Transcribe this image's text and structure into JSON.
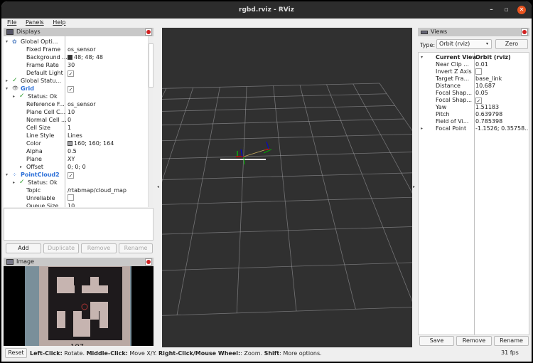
{
  "window": {
    "title": "rgbd.rviz - RViz",
    "minimize_icon": "minimize-icon",
    "maximize_icon": "maximize-icon",
    "close_icon": "close-icon"
  },
  "menu": [
    "File",
    "Panels",
    "Help"
  ],
  "displays": {
    "title": "Displays",
    "rows": [
      {
        "k": "Global Opti...",
        "v": "",
        "indent": 0,
        "exp": "down",
        "icon": "gear",
        "vtype": "text"
      },
      {
        "k": "Fixed Frame",
        "v": "os_sensor",
        "indent": 2,
        "vtype": "text"
      },
      {
        "k": "Background ...",
        "v": "48; 48; 48",
        "indent": 2,
        "vtype": "color",
        "color": "#303030"
      },
      {
        "k": "Frame Rate",
        "v": "30",
        "indent": 2,
        "vtype": "text"
      },
      {
        "k": "Default Light",
        "v": "✓",
        "indent": 2,
        "vtype": "check"
      },
      {
        "k": "Global Statu...",
        "v": "",
        "indent": 0,
        "exp": "right",
        "icon": "check",
        "vtype": "text"
      },
      {
        "k": "Grid",
        "v": "✓",
        "indent": 0,
        "exp": "down",
        "icon": "grid",
        "vtype": "check",
        "blue": true
      },
      {
        "k": "Status: Ok",
        "v": "",
        "indent": 1,
        "exp": "right",
        "icon": "check",
        "vtype": "text"
      },
      {
        "k": "Reference F...",
        "v": "os_sensor",
        "indent": 2,
        "vtype": "text"
      },
      {
        "k": "Plane Cell C...",
        "v": "10",
        "indent": 2,
        "vtype": "text"
      },
      {
        "k": "Normal Cell ...",
        "v": "0",
        "indent": 2,
        "vtype": "text"
      },
      {
        "k": "Cell Size",
        "v": "1",
        "indent": 2,
        "vtype": "text"
      },
      {
        "k": "Line Style",
        "v": "Lines",
        "indent": 2,
        "vtype": "text"
      },
      {
        "k": "Color",
        "v": "160; 160; 164",
        "indent": 2,
        "vtype": "color",
        "color": "#a0a0a4"
      },
      {
        "k": "Alpha",
        "v": "0.5",
        "indent": 2,
        "vtype": "text"
      },
      {
        "k": "Plane",
        "v": "XY",
        "indent": 2,
        "vtype": "text"
      },
      {
        "k": "Offset",
        "v": "0; 0; 0",
        "indent": 2,
        "exp": "right",
        "vtype": "text"
      },
      {
        "k": "PointCloud2",
        "v": "✓",
        "indent": 0,
        "exp": "down",
        "icon": "cloud",
        "vtype": "check",
        "blue": true
      },
      {
        "k": "Status: Ok",
        "v": "",
        "indent": 1,
        "exp": "right",
        "icon": "check",
        "vtype": "text"
      },
      {
        "k": "Topic",
        "v": "/rtabmap/cloud_map",
        "indent": 2,
        "vtype": "text"
      },
      {
        "k": "Unreliable",
        "v": "",
        "indent": 2,
        "vtype": "check"
      },
      {
        "k": "Queue Size",
        "v": "10",
        "indent": 2,
        "vtype": "text"
      }
    ],
    "buttons": {
      "add": "Add",
      "duplicate": "Duplicate",
      "remove": "Remove",
      "rename": "Rename"
    }
  },
  "image_panel": {
    "title": "Image",
    "marker_caption": "107"
  },
  "views": {
    "title": "Views",
    "type_label": "Type:",
    "type_value": "Orbit (rviz)",
    "zero": "Zero",
    "rows": [
      {
        "k": "Current View",
        "v": "Orbit (rviz)",
        "bold": true,
        "exp": "down",
        "vtype": "text"
      },
      {
        "k": "Near Clip ...",
        "v": "0.01",
        "vtype": "text"
      },
      {
        "k": "Invert Z Axis",
        "v": "",
        "vtype": "check"
      },
      {
        "k": "Target Fra...",
        "v": "base_link",
        "vtype": "text"
      },
      {
        "k": "Distance",
        "v": "10.687",
        "vtype": "text"
      },
      {
        "k": "Focal Shap...",
        "v": "0.05",
        "vtype": "text"
      },
      {
        "k": "Focal Shap...",
        "v": "✓",
        "vtype": "check"
      },
      {
        "k": "Yaw",
        "v": "1.51183",
        "vtype": "text"
      },
      {
        "k": "Pitch",
        "v": "0.639798",
        "vtype": "text"
      },
      {
        "k": "Field of Vi...",
        "v": "0.785398",
        "vtype": "text"
      },
      {
        "k": "Focal Point",
        "v": "-1.1526; 0.35758...",
        "exp": "right",
        "vtype": "text"
      }
    ],
    "buttons": {
      "save": "Save",
      "remove": "Remove",
      "rename": "Rename"
    }
  },
  "status": {
    "reset": "Reset",
    "parts": [
      [
        "Left-Click:",
        true
      ],
      [
        " Rotate. ",
        false
      ],
      [
        "Middle-Click:",
        true
      ],
      [
        " Move X/Y. ",
        false
      ],
      [
        "Right-Click/Mouse Wheel:",
        true
      ],
      [
        ": Zoom. ",
        false
      ],
      [
        "Shift",
        true
      ],
      [
        ": More options.",
        false
      ]
    ],
    "fps": "31 fps"
  },
  "viewport": {
    "background": "#303030",
    "grid_color": "#a0a0a4",
    "grid_cells": 10
  }
}
